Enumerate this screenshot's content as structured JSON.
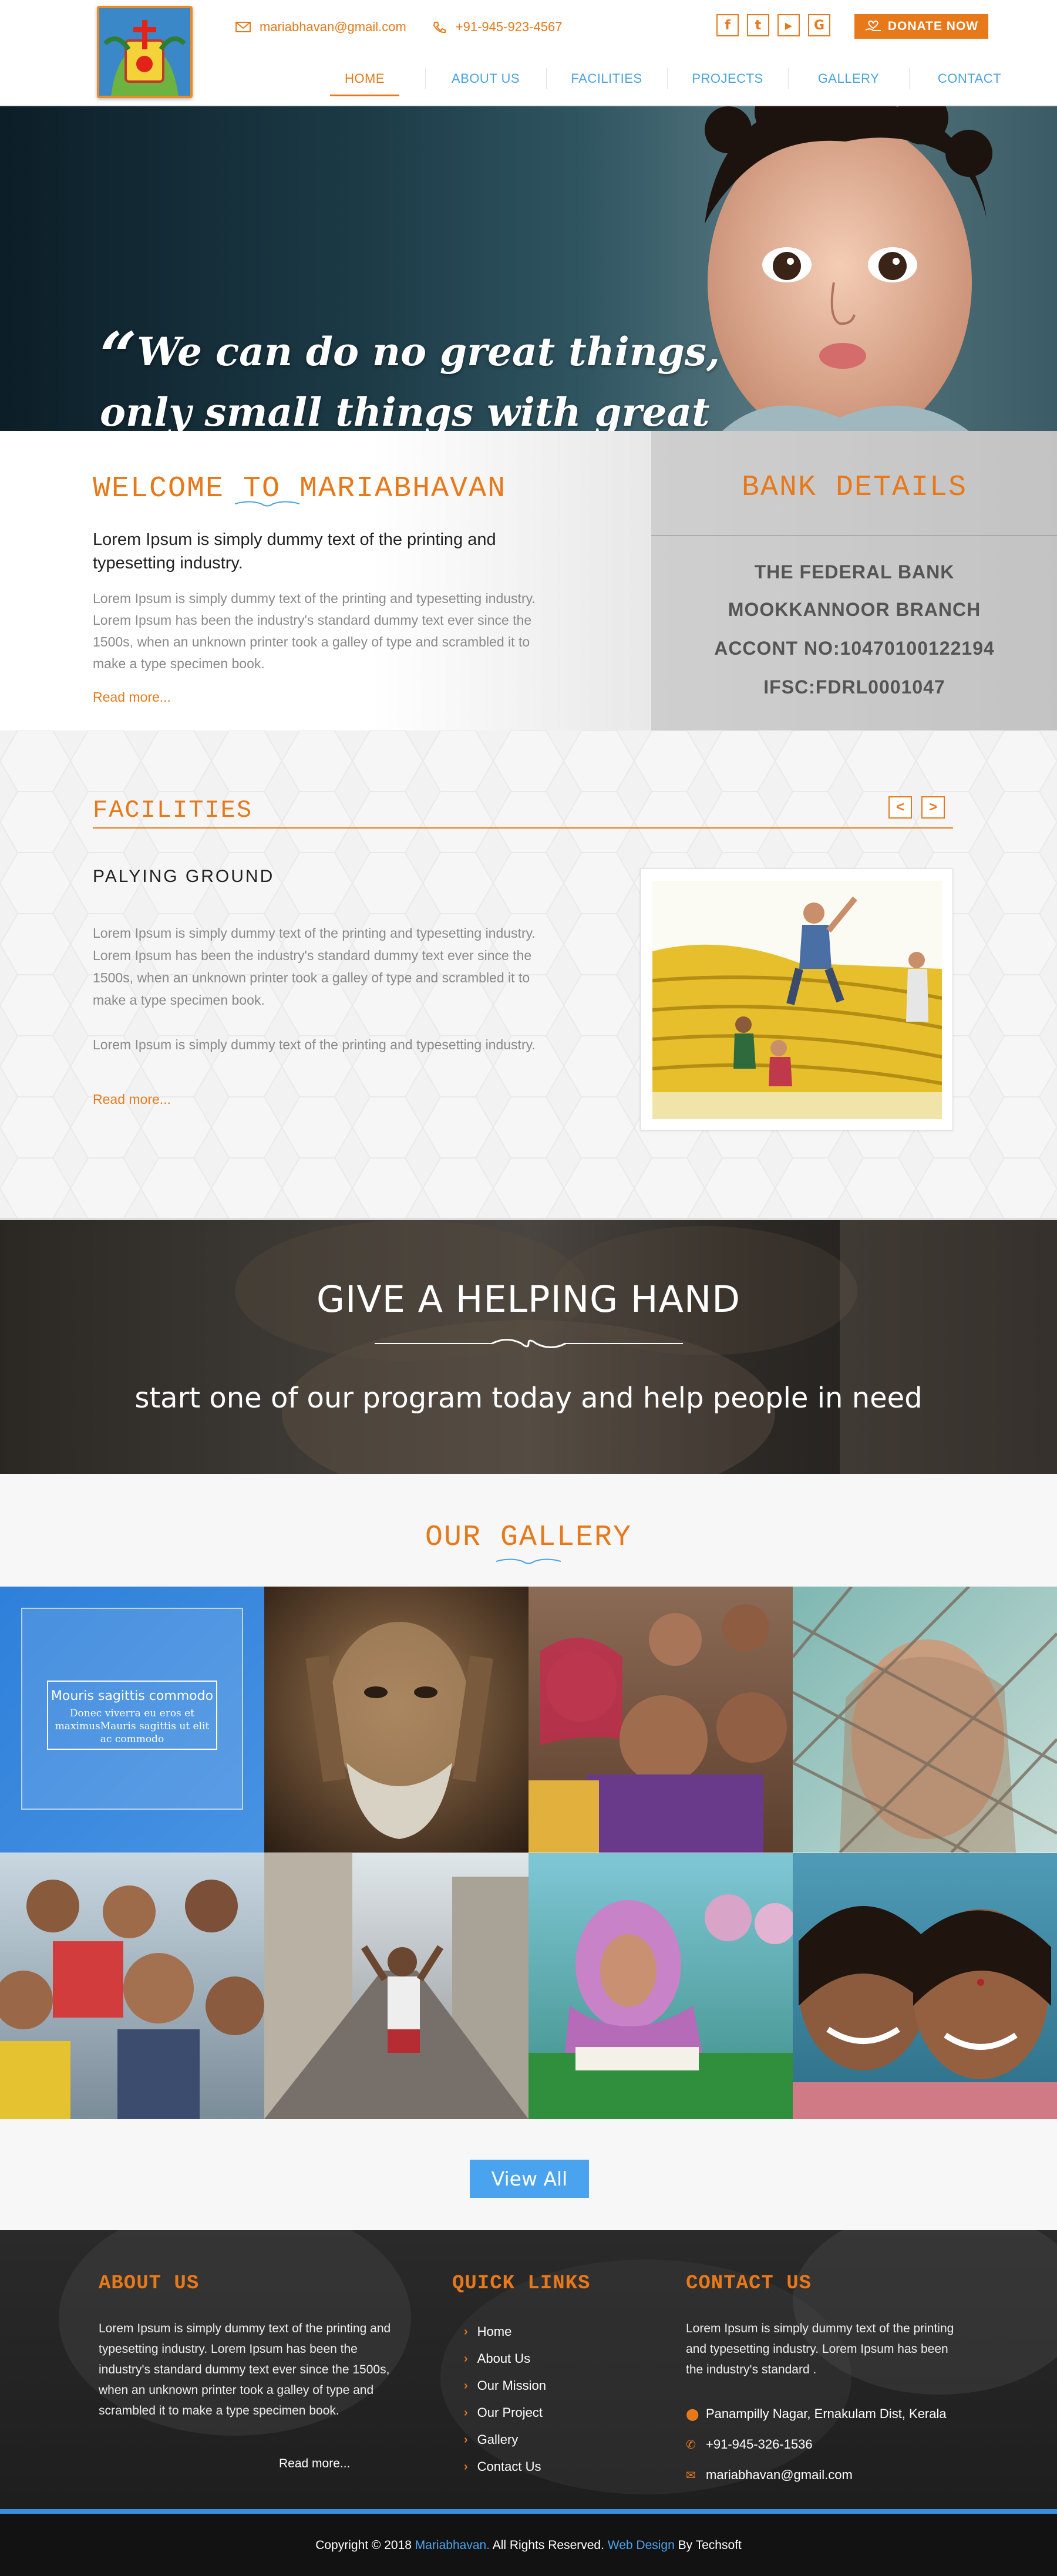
{
  "header": {
    "email": "mariabhavan@gmail.com",
    "phone": "+91-945-923-4567",
    "social": [
      {
        "icon": "facebook-icon",
        "label": "f"
      },
      {
        "icon": "twitter-icon",
        "label": "t"
      },
      {
        "icon": "youtube-icon",
        "label": "▶"
      },
      {
        "icon": "google-plus-icon",
        "label": "G"
      }
    ],
    "donate_label": "DONATE NOW"
  },
  "nav": {
    "items": [
      "HOME",
      "ABOUT US",
      "FACILITIES",
      "PROJECTS",
      "GALLERY",
      "CONTACT"
    ],
    "active": "HOME"
  },
  "hero": {
    "quote_line1": "We can do no great things,",
    "quote_line2": "only small things with great love."
  },
  "welcome": {
    "title": "WELCOME TO MARIABHAVAN",
    "lead": "Lorem Ipsum is simply dummy text of the printing and typesetting industry.",
    "body": "Lorem Ipsum is simply dummy text of the printing and typesetting industry. Lorem Ipsum has been the industry's standard dummy text ever since the 1500s, when an unknown printer took a galley of type and scrambled it to make a type specimen book.",
    "read_more": "Read more..."
  },
  "bank": {
    "title": "BANK DETAILS",
    "lines": [
      "THE FEDERAL BANK",
      "MOOKKANNOOR BRANCH",
      "ACCONT NO:10470100122194",
      "IFSC:FDRL0001047"
    ]
  },
  "facilities": {
    "title": "FACILITIES",
    "prev": "<",
    "next": ">",
    "subtitle": "PALYING GROUND",
    "p1": "Lorem Ipsum is simply dummy text of the printing and typesetting industry. Lorem Ipsum has been the industry's standard dummy text ever since the 1500s, when an unknown printer took a galley of type and scrambled it to make a type specimen book.",
    "p2": "Lorem Ipsum is simply dummy text of the printing and typesetting industry.",
    "read_more": "Read more..."
  },
  "help": {
    "title": "GIVE A HELPING HAND",
    "subtitle": "start one of our program today and help people in need"
  },
  "gallery": {
    "title": "OUR GALLERY",
    "overlay_title": "Mouris sagittis commodo",
    "overlay_text": "Donec viverra eu eros et maximusMauris sagittis ut elit ac commodo",
    "view_all": "View All"
  },
  "footer": {
    "about_title": "ABOUT US",
    "about_text": "Lorem Ipsum is simply dummy text of the printing and typesetting industry. Lorem Ipsum has been the industry's standard dummy text ever since the 1500s, when an unknown printer took a galley of type and scrambled it to make a type specimen book.",
    "about_more": "Read more...",
    "links_title": "QUICK LINKS",
    "links": [
      "Home",
      "About Us",
      "Our Mission",
      "Our Project",
      "Gallery",
      "Contact Us"
    ],
    "contact_title": "CONTACT US",
    "contact_text": "Lorem Ipsum is simply dummy text of the printing and typesetting industry. Lorem Ipsum has been the industry's standard .",
    "address": "Panampilly Nagar, Ernakulam Dist, Kerala",
    "phone": "+91-945-326-1536",
    "email": "mariabhavan@gmail.com"
  },
  "copyright": {
    "prefix": "Copyright © 2018 ",
    "brand": "Mariabhavan.",
    "middle": " All Rights Reserved. ",
    "design": "Web Design",
    "suffix": " By Techsoft"
  },
  "colors": {
    "accent": "#e8791a",
    "link": "#4aa3df",
    "button": "#4aa3ef"
  }
}
